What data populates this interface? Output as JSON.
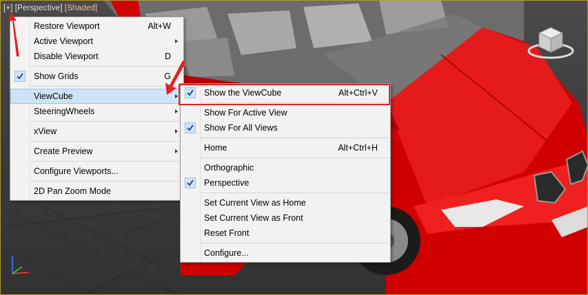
{
  "viewport_labels": {
    "plus": "[+]",
    "view": "[Perspective]",
    "shading": "[Shaded]"
  },
  "viewport_menu": {
    "items": [
      {
        "label": "Restore Viewport",
        "shortcut": "Alt+W"
      },
      {
        "label": "Active Viewport",
        "submenu": true
      },
      {
        "label": "Disable Viewport",
        "shortcut": "D"
      },
      {
        "label": "Show Grids",
        "shortcut": "G",
        "checked": true
      },
      {
        "label": "ViewCube",
        "submenu": true,
        "highlighted": true
      },
      {
        "label": "SteeringWheels",
        "submenu": true
      },
      {
        "label": "xView",
        "submenu": true
      },
      {
        "label": "Create Preview",
        "submenu": true
      },
      {
        "label": "Configure Viewports..."
      },
      {
        "label": "2D Pan Zoom Mode"
      }
    ]
  },
  "viewcube_submenu": {
    "items": [
      {
        "label": "Show the ViewCube",
        "shortcut": "Alt+Ctrl+V",
        "checked": true
      },
      {
        "label": "Show For Active View"
      },
      {
        "label": "Show For All Views",
        "checked": true
      },
      {
        "label": "Home",
        "shortcut": "Alt+Ctrl+H"
      },
      {
        "label": "Orthographic"
      },
      {
        "label": "Perspective",
        "checked": true
      },
      {
        "label": "Set Current View as Home"
      },
      {
        "label": "Set Current View as Front"
      },
      {
        "label": "Reset Front"
      },
      {
        "label": "Configure..."
      }
    ]
  },
  "colors": {
    "car_red": "#d10000",
    "highlight": "#cfe3f7",
    "annotation_red": "#e02424",
    "viewport_border": "#b59a2d"
  },
  "icons": [
    "check-icon",
    "submenu-arrow-icon",
    "viewcube-icon",
    "axis-tripod-icon",
    "annotation-arrow-icon"
  ]
}
